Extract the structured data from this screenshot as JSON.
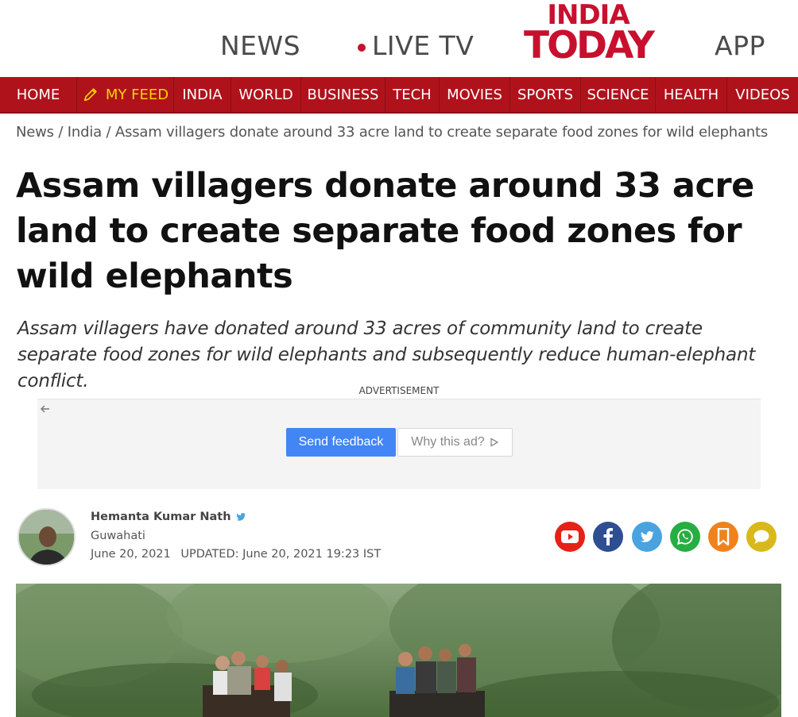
{
  "top_header": {
    "news_label": "NEWS",
    "live_tv_label": "LIVE TV",
    "logo_line1": "INDIA",
    "logo_line2": "TODAY",
    "app_label": "APP"
  },
  "nav": {
    "items": [
      "HOME",
      "MY FEED",
      "INDIA",
      "WORLD",
      "BUSINESS",
      "TECH",
      "MOVIES",
      "SPORTS",
      "SCIENCE",
      "HEALTH",
      "VIDEOS"
    ]
  },
  "breadcrumb": {
    "news": "News",
    "india": "India",
    "current": "Assam villagers donate around 33 acre land to create separate food zones for wild elephants",
    "separator": "/"
  },
  "article": {
    "headline": "Assam villagers donate around 33 acre land to create separate food zones for wild elephants",
    "summary": "Assam villagers have donated around 33 acres of community land to create separate food zones for wild elephants and subsequently reduce human-elephant conflict."
  },
  "ad": {
    "label": "ADVERTISEMENT",
    "back_icon": "arrow-left-icon",
    "send_feedback": "Send feedback",
    "why_this_ad": "Why this ad?"
  },
  "author": {
    "name": "Hemanta Kumar Nath",
    "location": "Guwahati",
    "published": "June 20, 2021",
    "updated": "UPDATED: June 20, 2021 19:23 IST"
  },
  "share_icons": [
    {
      "name": "youtube-icon",
      "color": "#e62117"
    },
    {
      "name": "facebook-icon",
      "color": "#2d4e93"
    },
    {
      "name": "twitter-icon",
      "color": "#4aa3df"
    },
    {
      "name": "whatsapp-icon",
      "color": "#27ae42"
    },
    {
      "name": "bookmark-icon",
      "color": "#f0821e"
    },
    {
      "name": "comment-icon",
      "color": "#d9b81a"
    }
  ],
  "colors": {
    "brand_red": "#c8102e",
    "nav_red": "#b0121b",
    "myfeed_yellow": "#f5d300",
    "feedback_blue": "#4285f4"
  }
}
